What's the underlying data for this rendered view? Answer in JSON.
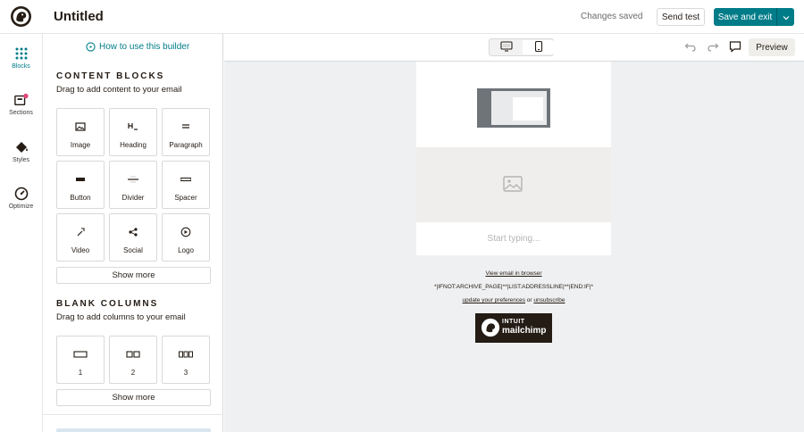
{
  "header": {
    "title": "Untitled",
    "status": "Changes saved",
    "send_test_label": "Send test",
    "save_exit_label": "Save and exit"
  },
  "rail": {
    "items": [
      {
        "label": "Blocks",
        "icon": "grid-icon"
      },
      {
        "label": "Sections",
        "icon": "sections-icon"
      },
      {
        "label": "Styles",
        "icon": "paint-bucket-icon"
      },
      {
        "label": "Optimize",
        "icon": "gauge-icon"
      }
    ]
  },
  "panel": {
    "howto_label": "How to use this builder",
    "content_blocks": {
      "title": "CONTENT BLOCKS",
      "subtitle": "Drag to add content to your email",
      "tiles": [
        {
          "label": "Image",
          "icon": "image-icon"
        },
        {
          "label": "Heading",
          "icon": "heading-icon"
        },
        {
          "label": "Paragraph",
          "icon": "paragraph-icon"
        },
        {
          "label": "Button",
          "icon": "button-icon"
        },
        {
          "label": "Divider",
          "icon": "divider-icon"
        },
        {
          "label": "Spacer",
          "icon": "spacer-icon"
        },
        {
          "label": "Video",
          "icon": "video-icon"
        },
        {
          "label": "Social",
          "icon": "share-icon"
        },
        {
          "label": "Logo",
          "icon": "logo-icon"
        }
      ],
      "show_more_label": "Show more"
    },
    "blank_columns": {
      "title": "BLANK COLUMNS",
      "subtitle": "Drag to add columns to your email",
      "tiles": [
        {
          "label": "1",
          "icon": "one-column-icon"
        },
        {
          "label": "2",
          "icon": "two-columns-icon"
        },
        {
          "label": "3",
          "icon": "three-columns-icon"
        }
      ],
      "show_more_label": "Show more"
    }
  },
  "toolbar": {
    "preview_label": "Preview"
  },
  "email": {
    "text_placeholder": "Start typing...",
    "view_in_browser": "View email in browser",
    "merge_tags": "*|IFNOT:ARCHIVE_PAGE|**|LIST:ADDRESSLINE|**|END:IF|*",
    "update_prefs": "update your preferences",
    "or_text": " or ",
    "unsubscribe": "unsubscribe",
    "badge_line1": "INTUIT",
    "badge_line2": "mailchimp"
  },
  "colors": {
    "accent": "#007c89",
    "text": "#241c15",
    "canvas": "#eef0f2"
  }
}
